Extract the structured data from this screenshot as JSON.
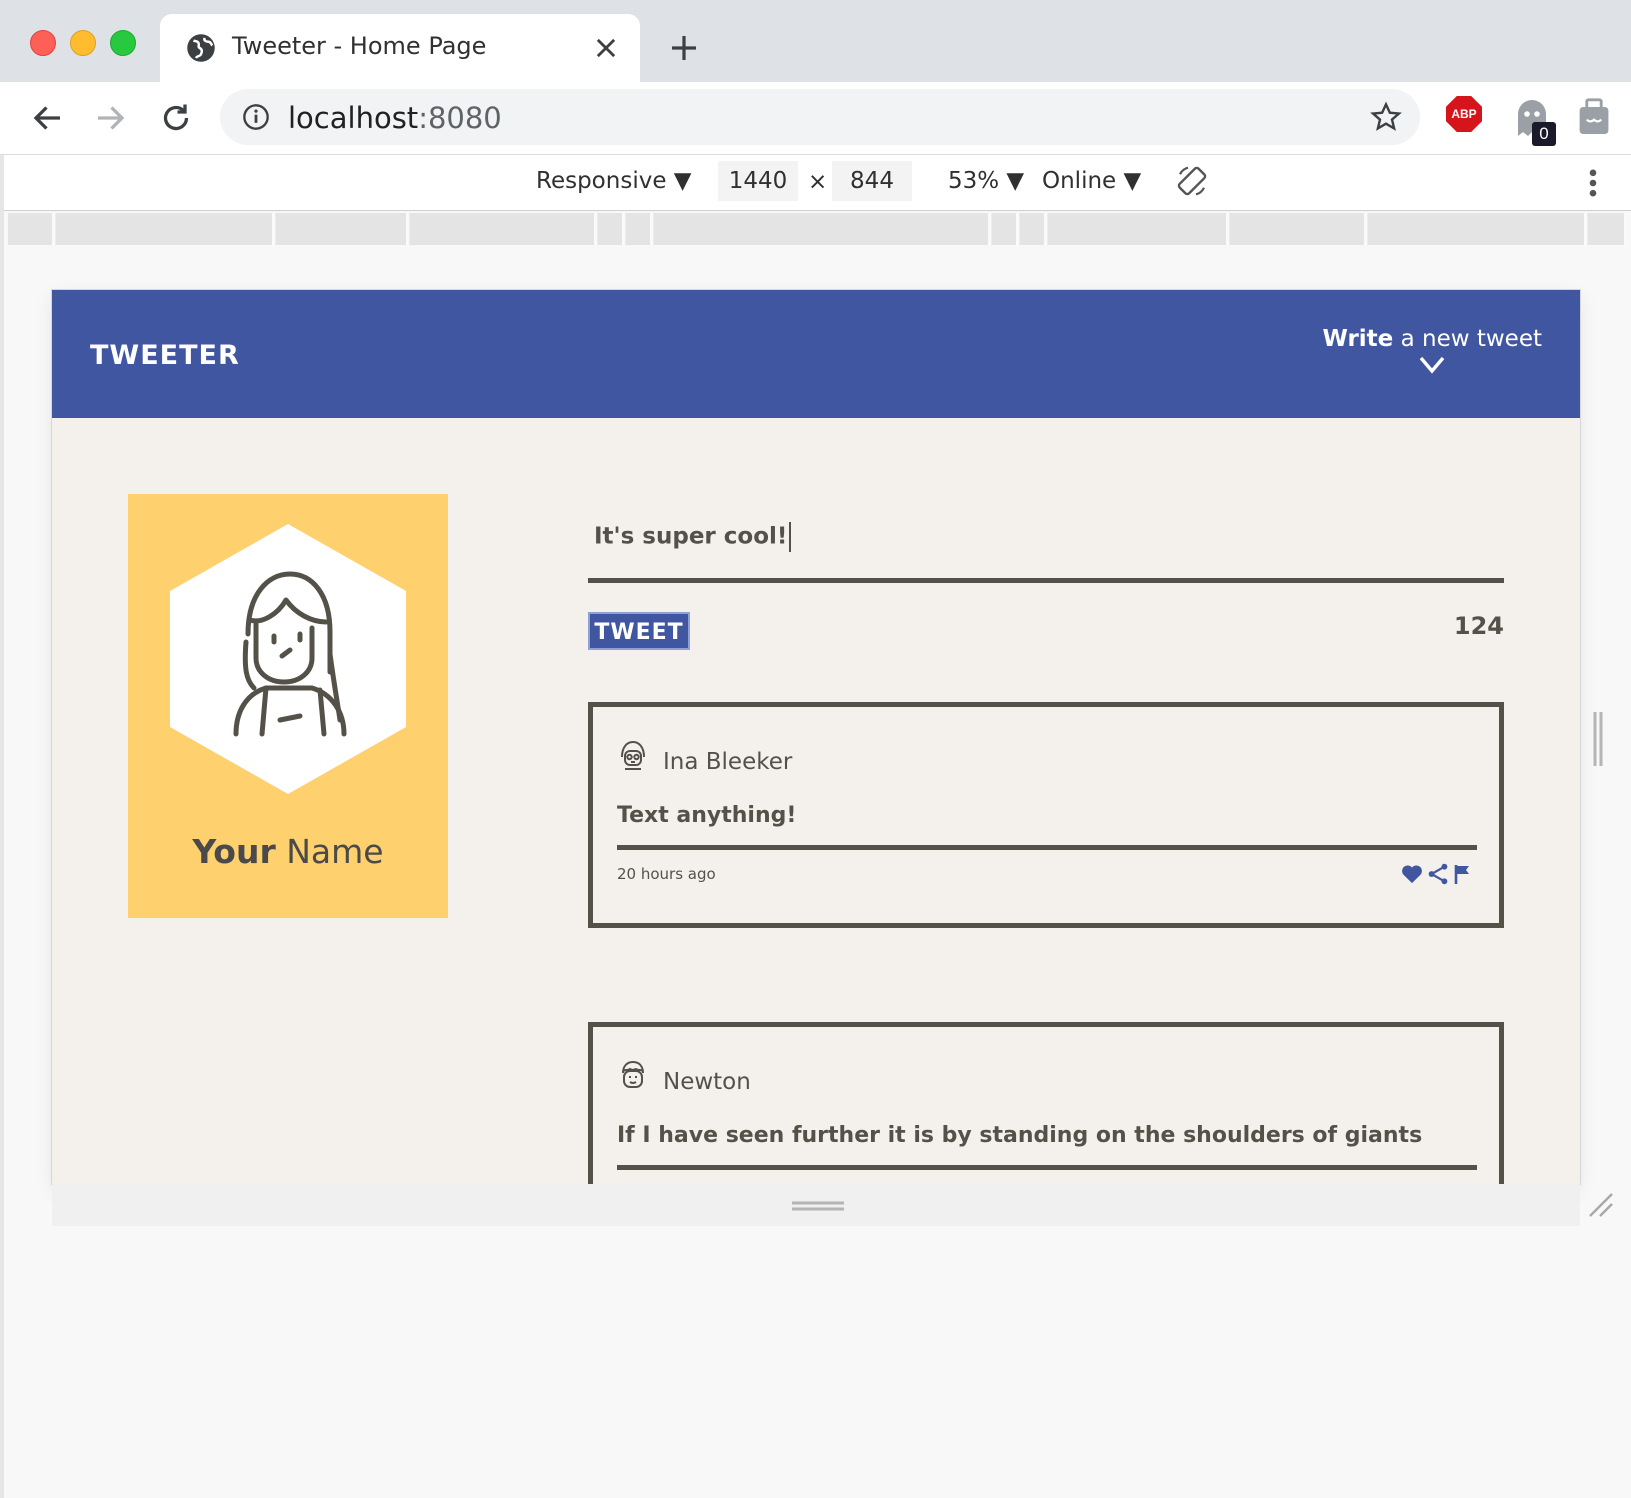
{
  "browser": {
    "tab_title": "Tweeter - Home Page",
    "url_host": "localhost",
    "url_port": ":8080",
    "extension_badge": "0",
    "abp_label": "ABP"
  },
  "devtools": {
    "device_mode": "Responsive",
    "width": "1440",
    "times": "×",
    "height": "844",
    "zoom": "53%",
    "throttling": "Online"
  },
  "app": {
    "logo": "TWEETER",
    "write_bold": "Write",
    "write_rest": " a new tweet",
    "profile": {
      "name_bold": "Your",
      "name_rest": " Name"
    },
    "compose": {
      "value": "It's super cool!",
      "button_label": "TWEET",
      "counter": "124"
    },
    "tweets": [
      {
        "author": "Ina Bleeker",
        "text": "Text anything!",
        "time": "20 hours ago"
      },
      {
        "author": "Newton",
        "text": "If I have seen further it is by standing on the shoulders of giants",
        "time": ""
      }
    ]
  },
  "colors": {
    "header_blue": "#4056a1",
    "profile_yellow": "#ffd06e",
    "page_bg": "#f4f1ec",
    "text_dark": "#545149"
  }
}
